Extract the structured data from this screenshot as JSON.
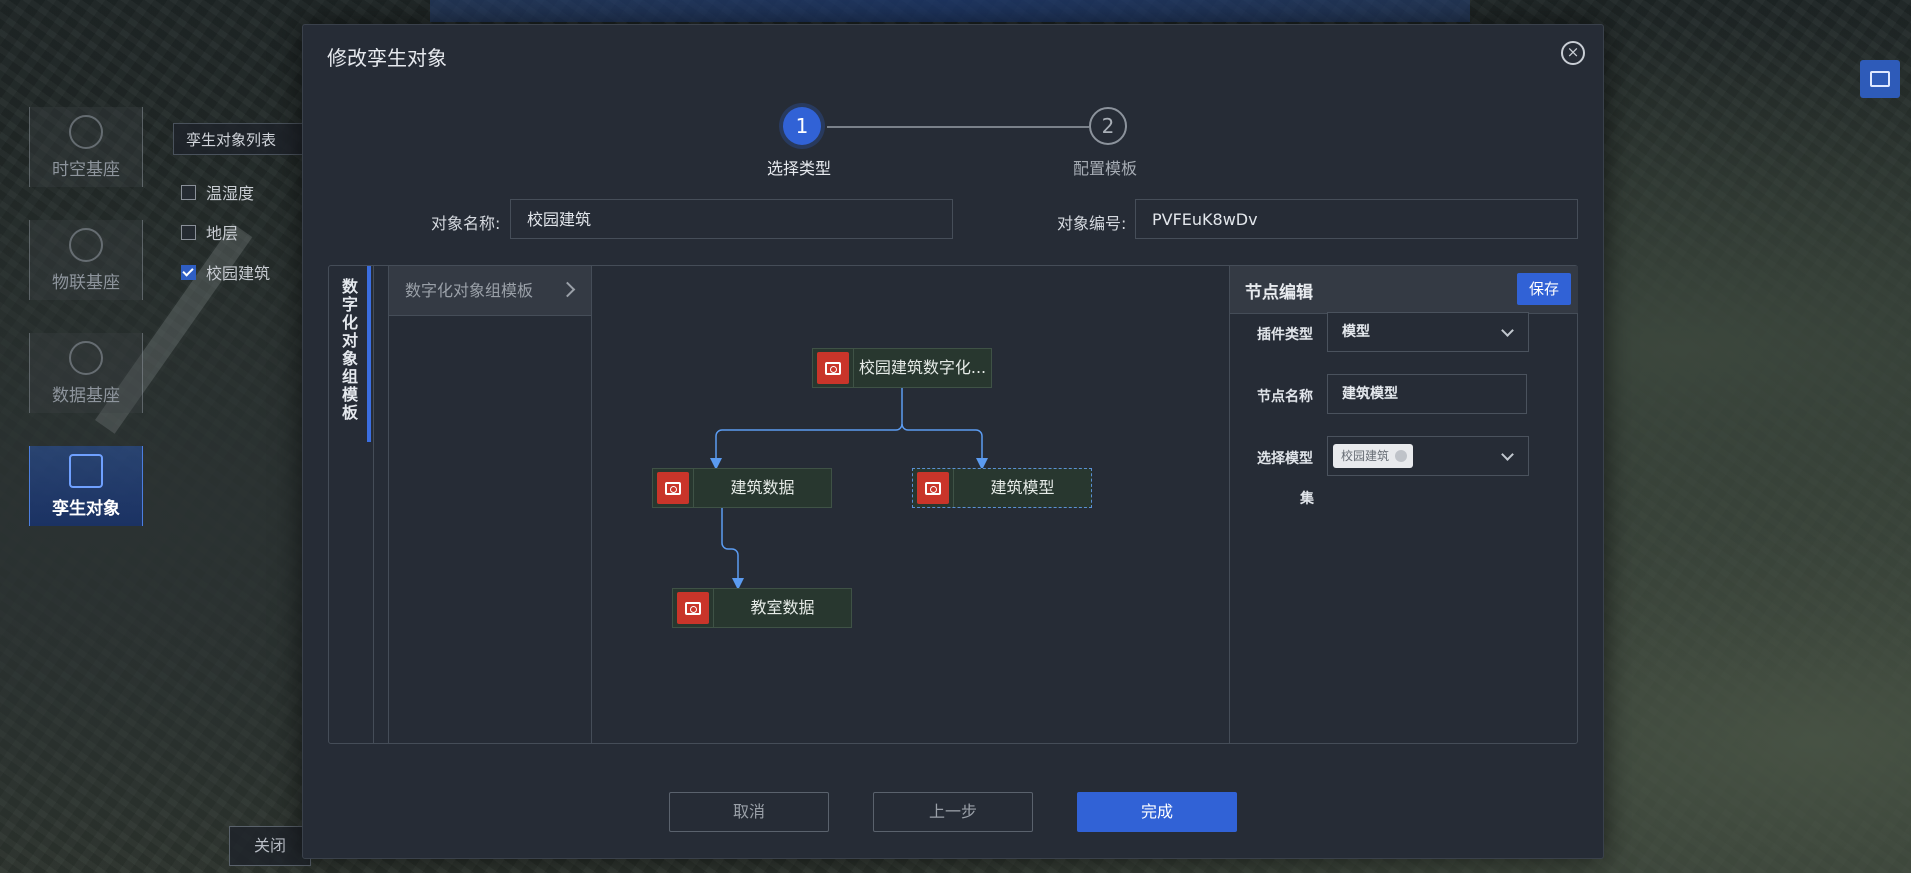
{
  "left_nav": [
    {
      "label": "时空基座",
      "icon": "compass-icon"
    },
    {
      "label": "物联基座",
      "icon": "network-icon"
    },
    {
      "label": "数据基座",
      "icon": "cloud-data-icon"
    },
    {
      "label": "孪生对象",
      "icon": "cubes-icon",
      "active": true
    }
  ],
  "object_list": {
    "select_value": "孪生对象列表",
    "items": [
      {
        "label": "温湿度",
        "checked": false
      },
      {
        "label": "地层",
        "checked": false
      },
      {
        "label": "校园建筑",
        "checked": true
      }
    ],
    "close_label": "关闭"
  },
  "modal": {
    "title": "修改孪生对象",
    "steps": [
      {
        "number": "1",
        "label": "选择类型",
        "active": true
      },
      {
        "number": "2",
        "label": "配置模板",
        "active": false
      }
    ],
    "name_label": "对象名称:",
    "name_value": "校园建筑",
    "code_label": "对象编号:",
    "code_value": "PVFEuK8wDv",
    "vertical_tab": "数字化对象组模板",
    "template_header": "数字化对象组模板",
    "nodes": [
      {
        "label": "校园建筑数字化...",
        "selected": false
      },
      {
        "label": "建筑数据",
        "selected": false
      },
      {
        "label": "建筑模型",
        "selected": true
      },
      {
        "label": "教室数据",
        "selected": false
      }
    ],
    "editor": {
      "title": "节点编辑",
      "save_label": "保存",
      "plugin_type_label": "插件类型",
      "plugin_type_value": "模型",
      "node_name_label": "节点名称",
      "node_name_value": "建筑模型",
      "model_set_label": "选择模型",
      "model_set_label_suffix": "集",
      "model_set_tag": "校园建筑"
    },
    "footer": {
      "cancel": "取消",
      "prev": "上一步",
      "done": "完成"
    }
  },
  "colors": {
    "accent": "#3162d6",
    "node_icon": "#c9352a",
    "modal_bg": "#262c36"
  }
}
